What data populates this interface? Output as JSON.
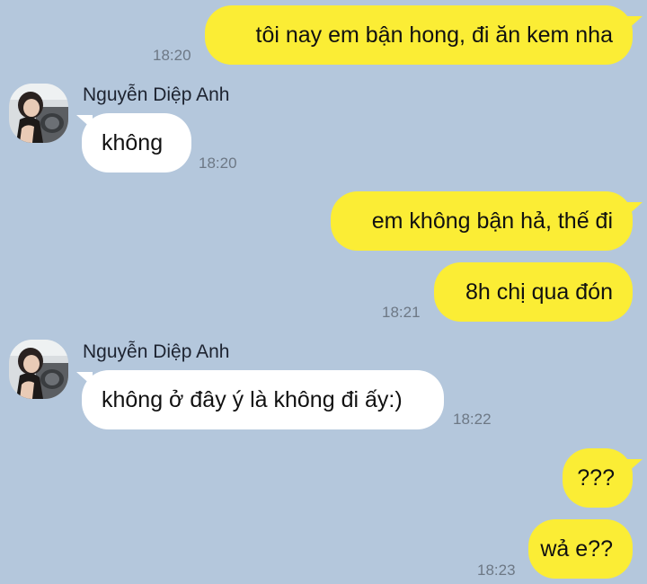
{
  "conversation": {
    "messages": [
      {
        "sender": "me",
        "text": "tôi nay em bận hong, đi ăn kem nha",
        "time": "18:20"
      },
      {
        "sender": "them",
        "name": "Nguyễn Diệp Anh",
        "text": "không",
        "time": "18:20"
      },
      {
        "sender": "me",
        "text": "em không bận hả, thế đi"
      },
      {
        "sender": "me",
        "text": "8h chị qua đón",
        "time": "18:21"
      },
      {
        "sender": "them",
        "name": "Nguyễn Diệp Anh",
        "text": "không ở đây ý là không đi ấy:)",
        "time": "18:22"
      },
      {
        "sender": "me",
        "text": "???"
      },
      {
        "sender": "me",
        "text": "wả e??",
        "time": "18:23"
      }
    ]
  },
  "colors": {
    "background": "#b4c7dc",
    "outgoing_bubble": "#fbed35",
    "incoming_bubble": "#ffffff",
    "timestamp": "#6d7885"
  },
  "icons": {
    "contact_avatar": "contact-avatar-photo"
  }
}
